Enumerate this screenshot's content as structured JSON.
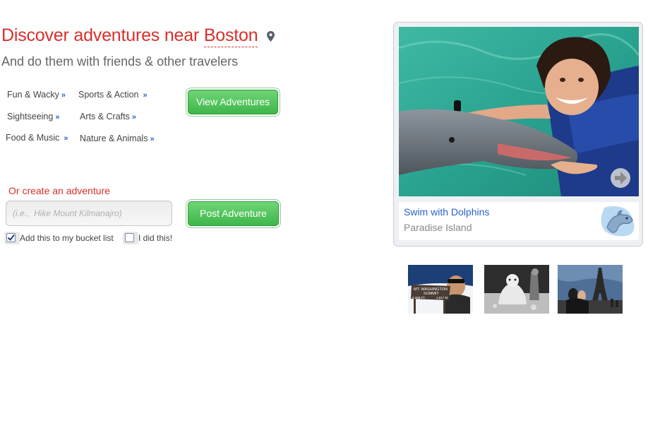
{
  "header": {
    "headline_prefix": "Discover adventures near",
    "city": "Boston",
    "subheadline": "And do them with friends & other travelers"
  },
  "categories": [
    {
      "label": "Fun & Wacky",
      "arrow": "»"
    },
    {
      "label": "Sports & Action",
      "arrow": "»"
    },
    {
      "label": "Sightseeing",
      "arrow": "»"
    },
    {
      "label": "Arts & Crafts",
      "arrow": "»"
    },
    {
      "label": "Food & Music",
      "arrow": "»"
    },
    {
      "label": "Nature & Animals",
      "arrow": "»"
    }
  ],
  "view_button": "View Adventures",
  "create": {
    "label": "Or create an adventure",
    "placeholder": "(i.e.,  Hike Mount Kilmanajro)",
    "post_button": "Post Adventure",
    "bucket_list": {
      "label": "Add this to my bucket list",
      "checked": true
    },
    "did_this": {
      "label": "I did this!",
      "checked": false
    }
  },
  "feature": {
    "title": "Swim with Dolphins",
    "location": "Paradise Island"
  },
  "thumbnails": [
    {
      "sign_lines": [
        "MT. WASHINGTON",
        "SUMMIT",
        "6,288 FT.",
        "1,917 M"
      ]
    },
    {},
    {}
  ],
  "colors": {
    "accent_red": "#d8302b",
    "link_blue": "#2a64c8",
    "button_green": "#3eb64a"
  }
}
